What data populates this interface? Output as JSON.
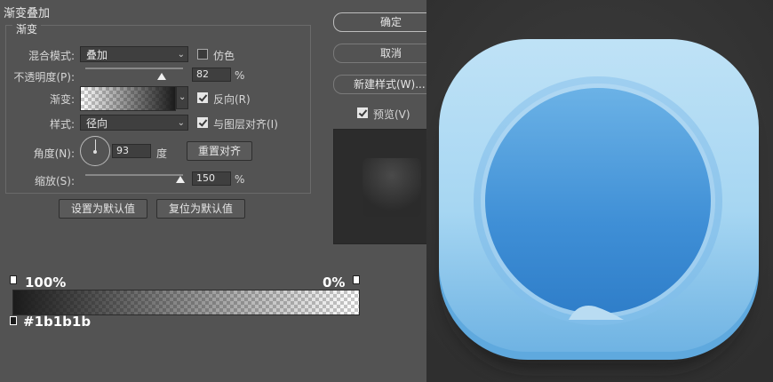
{
  "dialog": {
    "title": "渐变叠加",
    "group_title": "渐变",
    "blend_mode": {
      "label": "混合模式:",
      "value": "叠加"
    },
    "dither": {
      "label": "仿色",
      "checked": false
    },
    "opacity": {
      "label": "不透明度(P):",
      "value": "82",
      "unit": "%",
      "level": 0.82
    },
    "gradient": {
      "label": "渐变:"
    },
    "reverse": {
      "label": "反向(R)",
      "checked": true
    },
    "style": {
      "label": "样式:",
      "value": "径向"
    },
    "align_layer": {
      "label": "与图层对齐(I)",
      "checked": true
    },
    "angle": {
      "label": "角度(N):",
      "value": "93",
      "unit": "度"
    },
    "reset_align": "重置对齐",
    "scale": {
      "label": "缩放(S):",
      "value": "150",
      "unit": "%",
      "level": 0.75
    },
    "set_default": "设置为默认值",
    "reset_default": "复位为默认值"
  },
  "buttons": {
    "ok": "确定",
    "cancel": "取消",
    "new_style": "新建样式(W)...",
    "preview": {
      "label": "预览(V)",
      "checked": true
    }
  },
  "gradient_editor": {
    "left_opacity": "100%",
    "right_opacity": "0%",
    "color_stop": "#1b1b1b",
    "left_color": "#1b1b1b"
  }
}
